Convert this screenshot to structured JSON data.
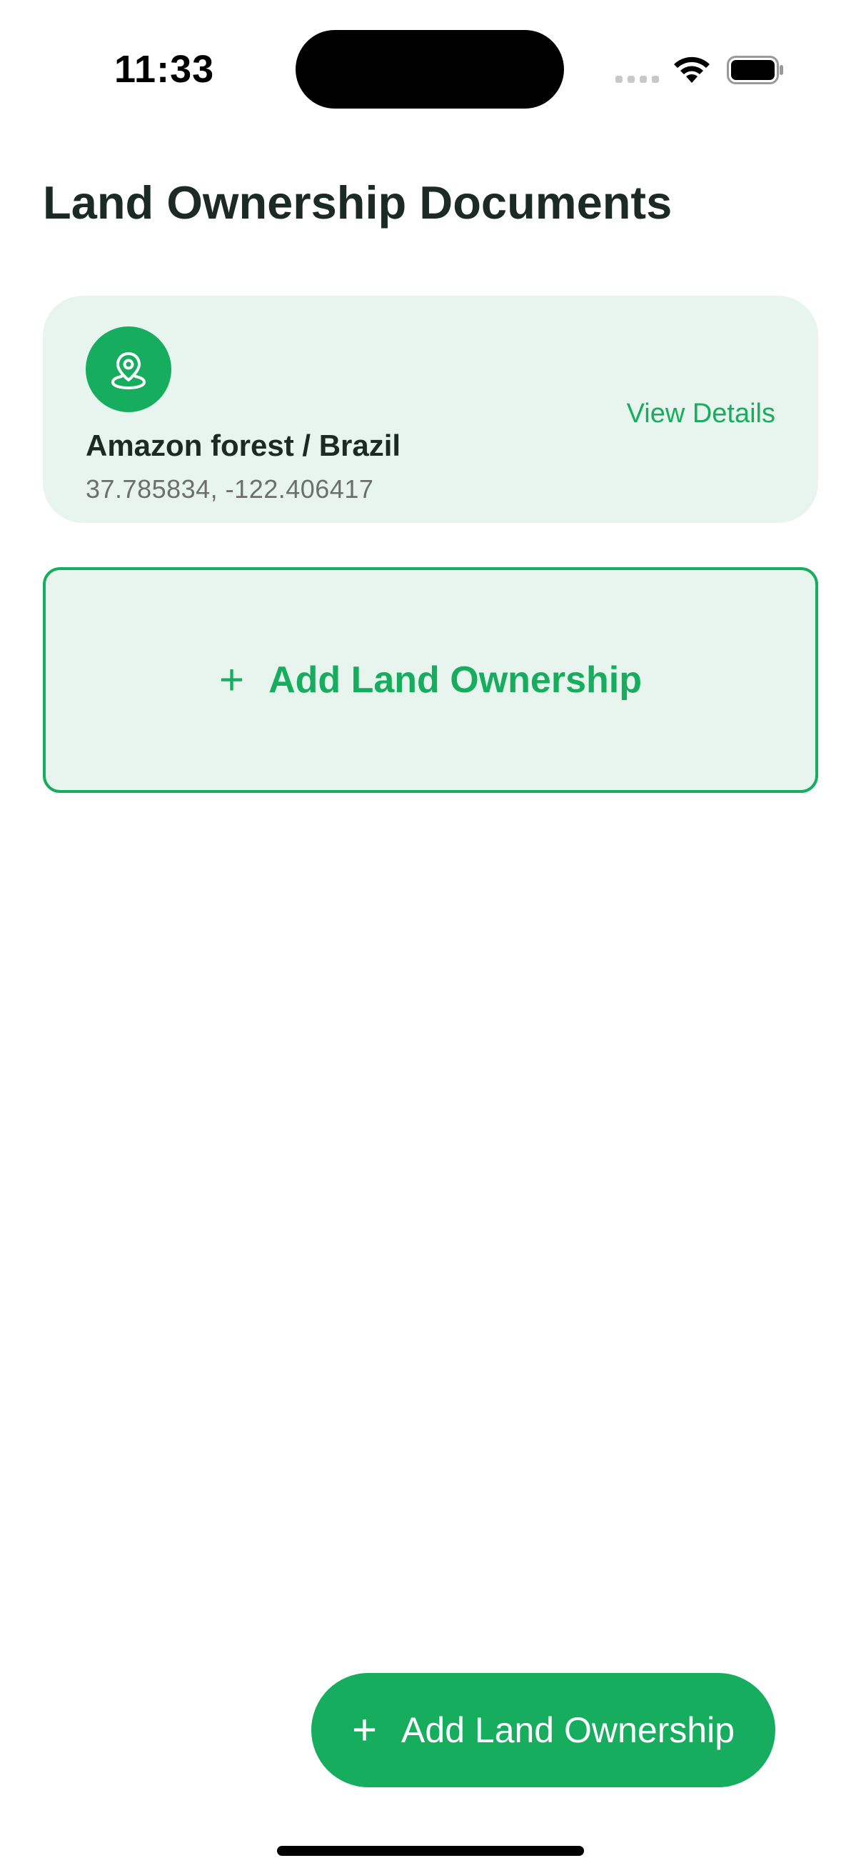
{
  "status_bar": {
    "time": "11:33",
    "icons": [
      "cellular-signal-icon",
      "wifi-icon",
      "battery-icon"
    ]
  },
  "page": {
    "title": "Land Ownership Documents"
  },
  "land_cards": [
    {
      "icon": "map-pin-icon",
      "name": "Amazon forest / Brazil",
      "coordinates": "37.785834, -122.406417",
      "action_label": "View Details"
    }
  ],
  "add_card": {
    "icon": "plus-icon",
    "label": "Add Land Ownership"
  },
  "fab": {
    "icon": "plus-icon",
    "label": "Add Land Ownership"
  },
  "colors": {
    "accent": "#17ad5e",
    "card_background": "#e8f5ee",
    "title_text": "#1b2a24",
    "secondary_text": "#6b6f6d"
  }
}
